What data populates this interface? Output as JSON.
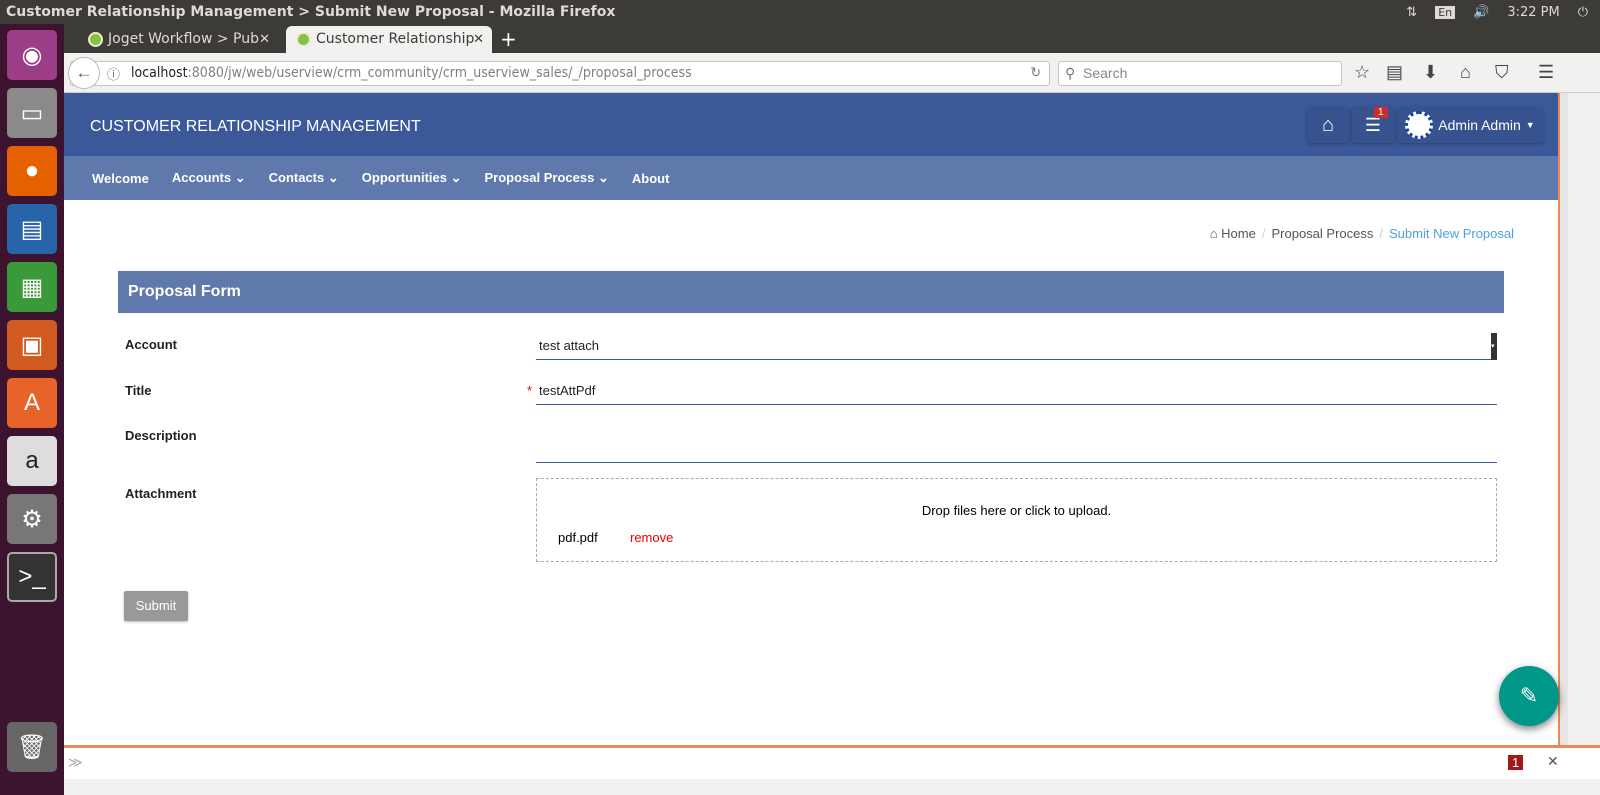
{
  "window": {
    "title": "Customer Relationship Management > Submit New Proposal - Mozilla Firefox"
  },
  "tray": {
    "lang": "En",
    "time": "3:22 PM"
  },
  "tabs": [
    {
      "label": "Joget Workflow > Pub"
    },
    {
      "label": "Customer Relationship"
    }
  ],
  "address": {
    "host": "localhost",
    "rest": ":8080/jw/web/userview/crm_community/crm_userview_sales/_/proposal_process"
  },
  "search": {
    "placeholder": "Search"
  },
  "app": {
    "title": "CUSTOMER RELATIONSHIP MANAGEMENT",
    "notif_count": "1",
    "user": "Admin Admin"
  },
  "menu": [
    {
      "label": "Welcome"
    },
    {
      "label": "Accounts"
    },
    {
      "label": "Contacts"
    },
    {
      "label": "Opportunities"
    },
    {
      "label": "Proposal Process"
    },
    {
      "label": "About"
    }
  ],
  "breadcrumb": {
    "home": "Home",
    "section": "Proposal Process",
    "current": "Submit New Proposal"
  },
  "form": {
    "title": "Proposal Form",
    "account": {
      "label": "Account",
      "value": "test attach"
    },
    "title_field": {
      "label": "Title",
      "value": "testAttPdf",
      "required": "*"
    },
    "description": {
      "label": "Description",
      "value": ""
    },
    "attachment": {
      "label": "Attachment",
      "hint": "Drop files here or click to upload.",
      "file": "pdf.pdf",
      "remove": "remove"
    },
    "submit": "Submit"
  },
  "bottom": {
    "badge": "1"
  }
}
